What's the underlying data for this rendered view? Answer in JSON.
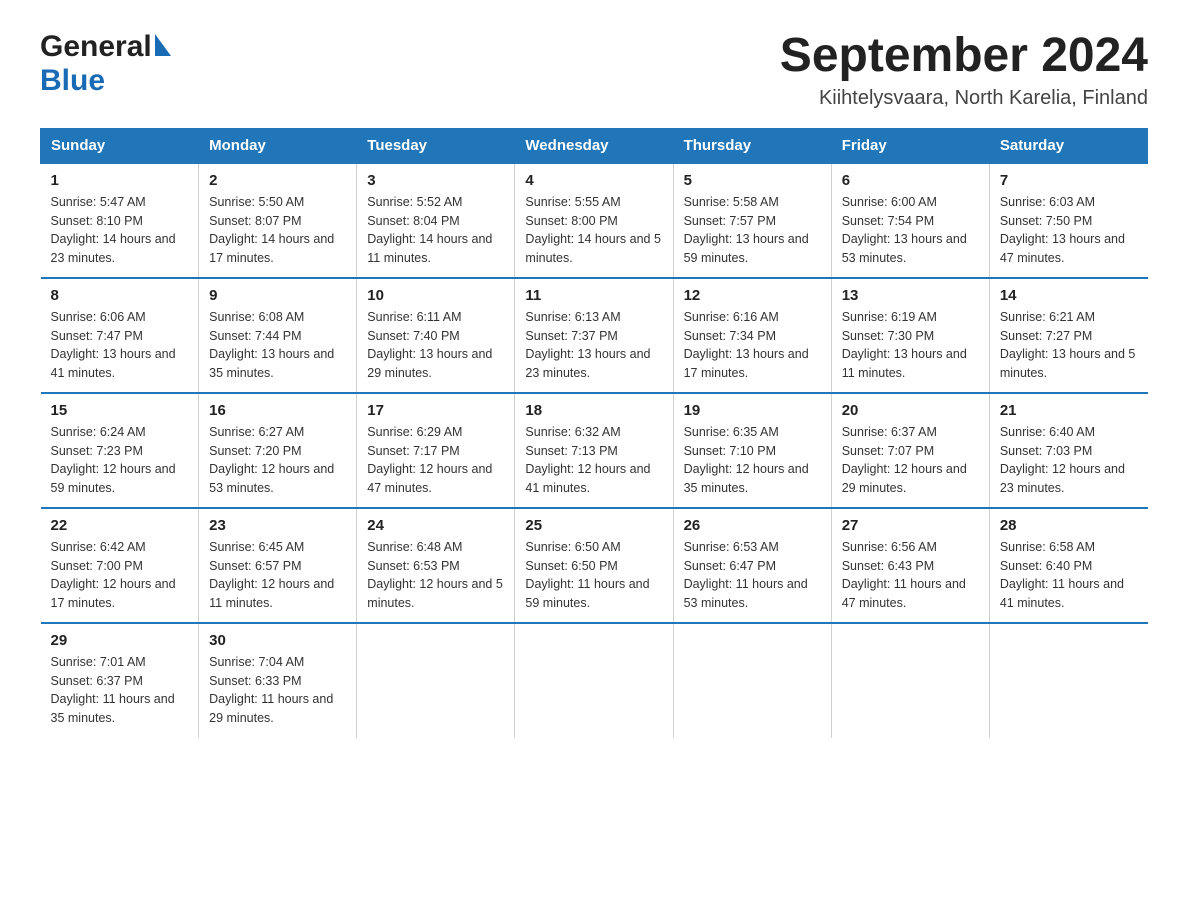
{
  "header": {
    "logo_general": "General",
    "logo_blue": "Blue",
    "month_title": "September 2024",
    "location": "Kiihtelysvaara, North Karelia, Finland"
  },
  "days_of_week": [
    "Sunday",
    "Monday",
    "Tuesday",
    "Wednesday",
    "Thursday",
    "Friday",
    "Saturday"
  ],
  "weeks": [
    [
      {
        "num": "1",
        "sunrise": "5:47 AM",
        "sunset": "8:10 PM",
        "daylight": "14 hours and 23 minutes."
      },
      {
        "num": "2",
        "sunrise": "5:50 AM",
        "sunset": "8:07 PM",
        "daylight": "14 hours and 17 minutes."
      },
      {
        "num": "3",
        "sunrise": "5:52 AM",
        "sunset": "8:04 PM",
        "daylight": "14 hours and 11 minutes."
      },
      {
        "num": "4",
        "sunrise": "5:55 AM",
        "sunset": "8:00 PM",
        "daylight": "14 hours and 5 minutes."
      },
      {
        "num": "5",
        "sunrise": "5:58 AM",
        "sunset": "7:57 PM",
        "daylight": "13 hours and 59 minutes."
      },
      {
        "num": "6",
        "sunrise": "6:00 AM",
        "sunset": "7:54 PM",
        "daylight": "13 hours and 53 minutes."
      },
      {
        "num": "7",
        "sunrise": "6:03 AM",
        "sunset": "7:50 PM",
        "daylight": "13 hours and 47 minutes."
      }
    ],
    [
      {
        "num": "8",
        "sunrise": "6:06 AM",
        "sunset": "7:47 PM",
        "daylight": "13 hours and 41 minutes."
      },
      {
        "num": "9",
        "sunrise": "6:08 AM",
        "sunset": "7:44 PM",
        "daylight": "13 hours and 35 minutes."
      },
      {
        "num": "10",
        "sunrise": "6:11 AM",
        "sunset": "7:40 PM",
        "daylight": "13 hours and 29 minutes."
      },
      {
        "num": "11",
        "sunrise": "6:13 AM",
        "sunset": "7:37 PM",
        "daylight": "13 hours and 23 minutes."
      },
      {
        "num": "12",
        "sunrise": "6:16 AM",
        "sunset": "7:34 PM",
        "daylight": "13 hours and 17 minutes."
      },
      {
        "num": "13",
        "sunrise": "6:19 AM",
        "sunset": "7:30 PM",
        "daylight": "13 hours and 11 minutes."
      },
      {
        "num": "14",
        "sunrise": "6:21 AM",
        "sunset": "7:27 PM",
        "daylight": "13 hours and 5 minutes."
      }
    ],
    [
      {
        "num": "15",
        "sunrise": "6:24 AM",
        "sunset": "7:23 PM",
        "daylight": "12 hours and 59 minutes."
      },
      {
        "num": "16",
        "sunrise": "6:27 AM",
        "sunset": "7:20 PM",
        "daylight": "12 hours and 53 minutes."
      },
      {
        "num": "17",
        "sunrise": "6:29 AM",
        "sunset": "7:17 PM",
        "daylight": "12 hours and 47 minutes."
      },
      {
        "num": "18",
        "sunrise": "6:32 AM",
        "sunset": "7:13 PM",
        "daylight": "12 hours and 41 minutes."
      },
      {
        "num": "19",
        "sunrise": "6:35 AM",
        "sunset": "7:10 PM",
        "daylight": "12 hours and 35 minutes."
      },
      {
        "num": "20",
        "sunrise": "6:37 AM",
        "sunset": "7:07 PM",
        "daylight": "12 hours and 29 minutes."
      },
      {
        "num": "21",
        "sunrise": "6:40 AM",
        "sunset": "7:03 PM",
        "daylight": "12 hours and 23 minutes."
      }
    ],
    [
      {
        "num": "22",
        "sunrise": "6:42 AM",
        "sunset": "7:00 PM",
        "daylight": "12 hours and 17 minutes."
      },
      {
        "num": "23",
        "sunrise": "6:45 AM",
        "sunset": "6:57 PM",
        "daylight": "12 hours and 11 minutes."
      },
      {
        "num": "24",
        "sunrise": "6:48 AM",
        "sunset": "6:53 PM",
        "daylight": "12 hours and 5 minutes."
      },
      {
        "num": "25",
        "sunrise": "6:50 AM",
        "sunset": "6:50 PM",
        "daylight": "11 hours and 59 minutes."
      },
      {
        "num": "26",
        "sunrise": "6:53 AM",
        "sunset": "6:47 PM",
        "daylight": "11 hours and 53 minutes."
      },
      {
        "num": "27",
        "sunrise": "6:56 AM",
        "sunset": "6:43 PM",
        "daylight": "11 hours and 47 minutes."
      },
      {
        "num": "28",
        "sunrise": "6:58 AM",
        "sunset": "6:40 PM",
        "daylight": "11 hours and 41 minutes."
      }
    ],
    [
      {
        "num": "29",
        "sunrise": "7:01 AM",
        "sunset": "6:37 PM",
        "daylight": "11 hours and 35 minutes."
      },
      {
        "num": "30",
        "sunrise": "7:04 AM",
        "sunset": "6:33 PM",
        "daylight": "11 hours and 29 minutes."
      },
      null,
      null,
      null,
      null,
      null
    ]
  ],
  "labels": {
    "sunrise": "Sunrise:",
    "sunset": "Sunset:",
    "daylight": "Daylight:"
  }
}
